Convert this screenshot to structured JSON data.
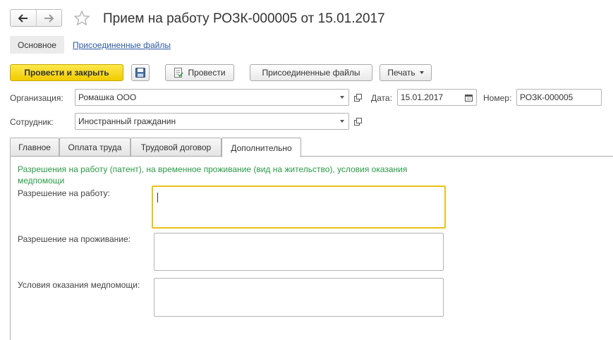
{
  "title": "Прием на работу РОЗК-000005 от 15.01.2017",
  "sections": {
    "main": "Основное",
    "attached_files": "Присоединенные файлы"
  },
  "toolbar": {
    "post_and_close": "Провести и закрыть",
    "post": "Провести",
    "attached_files": "Присоединенные файлы",
    "print": "Печать"
  },
  "header": {
    "organization_label": "Организация:",
    "organization_value": "Ромашка ООО",
    "date_label": "Дата:",
    "date_value": "15.01.2017",
    "number_label": "Номер:",
    "number_value": "РОЗК-000005",
    "employee_label": "Сотрудник:",
    "employee_value": "Иностранный гражданин"
  },
  "tabs": [
    {
      "label": "Главное"
    },
    {
      "label": "Оплата труда"
    },
    {
      "label": "Трудовой договор"
    },
    {
      "label": "Дополнительно",
      "active": true
    }
  ],
  "additional": {
    "group_title": "Разрешения на работу (патент), на временное проживание (вид на жительство), условия оказания медпомощи",
    "work_permit_label": "Разрешение на работу:",
    "work_permit_value": "",
    "residence_permit_label": "Разрешение на проживание:",
    "residence_permit_value": "",
    "medical_care_label": "Условия оказания медпомощи:",
    "medical_care_value": ""
  },
  "colors": {
    "primary_button": "#f5d10f",
    "group_title": "#2b9a47",
    "link": "#2e5aa7",
    "focus_border": "#e8c21a"
  },
  "icons": [
    "arrow-left-icon",
    "arrow-right-icon",
    "star-icon",
    "save-icon",
    "post-icon",
    "dropdown-icon",
    "open-icon",
    "calendar-icon"
  ]
}
